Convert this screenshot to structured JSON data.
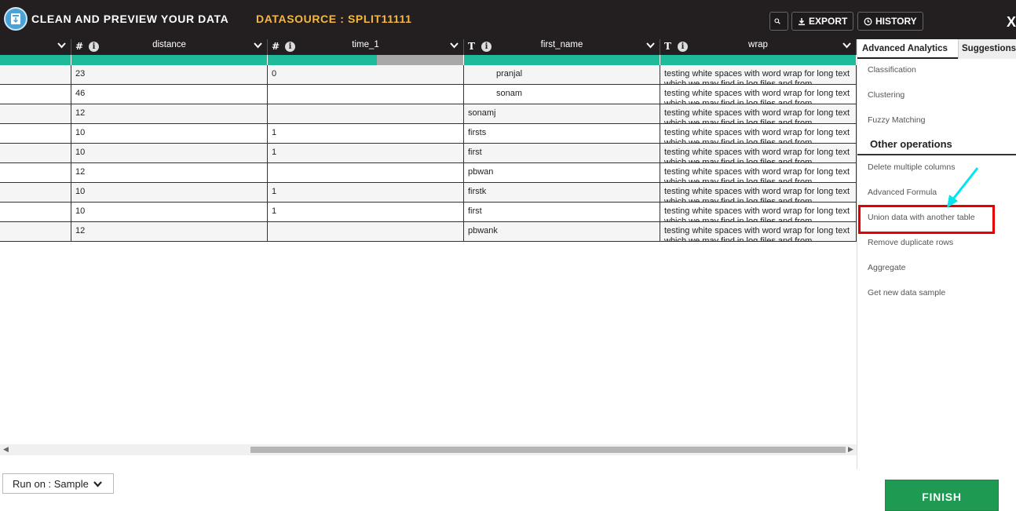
{
  "header": {
    "title": "CLEAN AND PREVIEW YOUR DATA",
    "datasource_label": "DATASOURCE : SPLIT11111",
    "export_label": "EXPORT",
    "history_label": "HISTORY",
    "close_label": "X"
  },
  "columns": [
    {
      "type": "",
      "name": ""
    },
    {
      "type": "#",
      "info": "i",
      "name": "distance"
    },
    {
      "type": "#",
      "info": "i",
      "name": "time_1"
    },
    {
      "type": "T",
      "info": "i",
      "name": "first_name"
    },
    {
      "type": "T",
      "info": "i",
      "name": "wrap"
    }
  ],
  "rows": [
    [
      "",
      "23",
      "0",
      "pranjal",
      "testing white spaces with word wrap for long text which we may find in log files and from streaming"
    ],
    [
      "",
      "46",
      "",
      "sonam",
      "testing white spaces with word wrap for long text which we may find in log files and from streaming"
    ],
    [
      "",
      "12",
      "",
      "sonamj",
      "testing white spaces with word wrap for long text which we may find in log files and from streaming"
    ],
    [
      "",
      "10",
      "1",
      "firsts",
      "testing white spaces with word wrap for long text which we may find in log files and from streaming"
    ],
    [
      "",
      "10",
      "1",
      "first",
      "testing white spaces with word wrap for long text which we may find in log files and from streaming"
    ],
    [
      "",
      "12",
      "",
      "pbwan",
      "testing white spaces with word wrap for long text which we may find in log files and from streaming"
    ],
    [
      "",
      "10",
      "1",
      "firstk",
      "testing white spaces with word wrap for long text which we may find in log files and from streaming"
    ],
    [
      "",
      "10",
      "1",
      "first",
      "testing white spaces with word wrap for long text which we may find in log files and from streaming"
    ],
    [
      "",
      "12",
      "",
      "pbwank",
      "testing white spaces with word wrap for long text which we may find in log files and from streaming"
    ]
  ],
  "panel": {
    "tabs": [
      "Advanced Analytics",
      "Suggestions"
    ],
    "analytics": [
      "Classification",
      "Clustering",
      "Fuzzy Matching"
    ],
    "other_title": "Other operations",
    "other": [
      "Delete multiple columns",
      "Advanced Formula",
      "Union data with another table",
      "Remove duplicate rows",
      "Aggregate",
      "Get new data sample"
    ]
  },
  "footer": {
    "run_on": "Run on : Sample",
    "finish": "FINISH"
  },
  "colors": {
    "topbar": "#231f20",
    "accent_teal": "#1fba99",
    "datasource": "#f5b841",
    "finish": "#1f9a52",
    "highlight": "#e60000",
    "arrow": "#00e5ee"
  },
  "icons": [
    "app-logo-icon",
    "search-icon",
    "export-icon",
    "history-icon",
    "info-icon",
    "chevron-down-icon",
    "arrow-annotation-icon"
  ]
}
